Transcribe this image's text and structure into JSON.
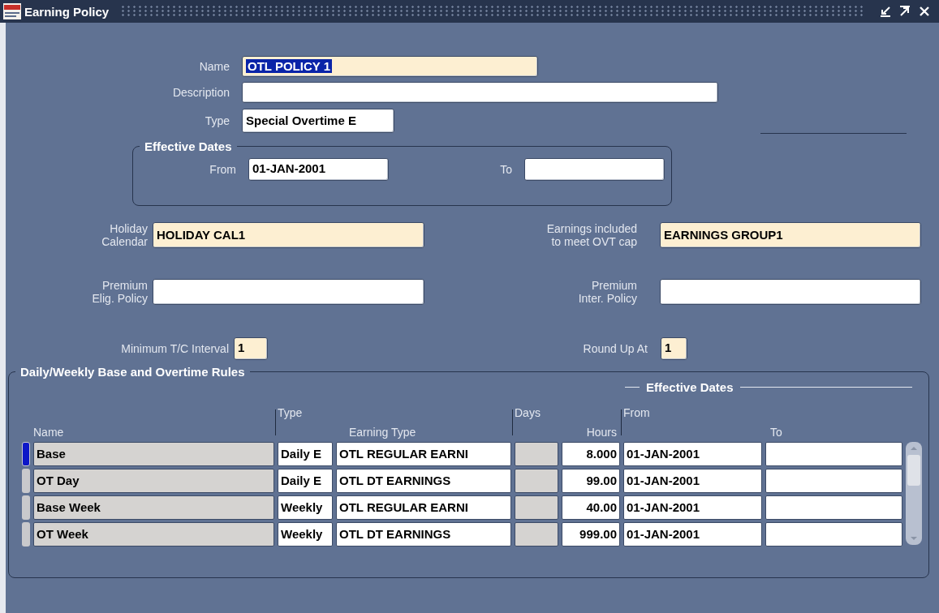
{
  "window": {
    "title": "Earning Policy"
  },
  "fields": [
    {
      "label": "Name",
      "value": "OTL POLICY 1",
      "required": true,
      "text_selected": true
    },
    {
      "label": "Description",
      "required": false,
      "text_selected": false
    },
    {
      "label": "Type",
      "value": "Special Overtime E",
      "required": false,
      "text_selected": false
    }
  ],
  "effective_dates": {
    "title": "Effective Dates",
    "from": {
      "label": "From",
      "value": "01-JAN-2001"
    },
    "to": {
      "label": "To"
    }
  },
  "policy_fields": [
    {
      "label": "Holiday\nCalendar",
      "value": "HOLIDAY CAL1",
      "required": true
    },
    {
      "label": "Earnings included\nto meet OVT cap",
      "value": "EARNINGS GROUP1",
      "required": true
    },
    {
      "label": "Premium\nElig. Policy",
      "required": false
    },
    {
      "label": "Premium\nInter. Policy",
      "required": false
    }
  ],
  "intervals": [
    {
      "label": "Minimum T/C Interval",
      "value": "1",
      "required": true
    },
    {
      "label": "Round Up At",
      "value": "1",
      "required": true
    }
  ],
  "rules": {
    "title": "Daily/Weekly Base and Overtime Rules",
    "group_header": "Effective Dates",
    "columns": {
      "name": "Name",
      "type": "Type",
      "earning_type": "Earning Type",
      "days": "Days",
      "hours": "Hours",
      "from": "From",
      "to": "To"
    },
    "rows": [
      {
        "name": "Base",
        "type": "Daily E",
        "earning_type": "OTL REGULAR EARNI",
        "hours": "8.000",
        "from": "01-JAN-2001",
        "selected": true
      },
      {
        "name": "OT Day",
        "type": "Daily E",
        "earning_type": "OTL DT EARNINGS",
        "hours": "99.00",
        "from": "01-JAN-2001",
        "selected": false
      },
      {
        "name": "Base Week",
        "type": "Weekly",
        "earning_type": "OTL REGULAR EARNI",
        "hours": "40.00",
        "from": "01-JAN-2001",
        "selected": false
      },
      {
        "name": "OT Week",
        "type": "Weekly",
        "earning_type": "OTL DT EARNINGS",
        "hours": "999.00",
        "from": "01-JAN-2001",
        "selected": false
      }
    ]
  }
}
